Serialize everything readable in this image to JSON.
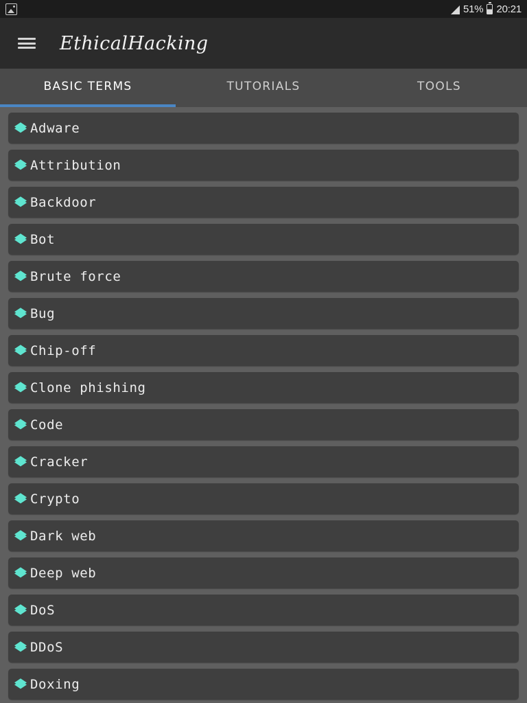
{
  "status_bar": {
    "notification_icon": "image-notification-icon",
    "signal_icon": "signal-bars-icon",
    "battery_percent": "51%",
    "battery_icon": "battery-icon",
    "time": "20:21"
  },
  "app_bar": {
    "menu_icon": "hamburger-menu-icon",
    "title": "EthicalHacking"
  },
  "tabs": [
    {
      "label": "BASIC TERMS",
      "active": true
    },
    {
      "label": "TUTORIALS",
      "active": false
    },
    {
      "label": "TOOLS",
      "active": false
    }
  ],
  "colors": {
    "status_bar_bg": "#1c1c1c",
    "app_bar_bg": "#2b2b2b",
    "tab_bar_bg": "#4a4a4a",
    "tab_indicator": "#4a86c4",
    "page_bg": "#5f5f5f",
    "card_bg": "#3f3f3f",
    "accent_icon": "#5fe5d0",
    "text_primary": "#ededed"
  },
  "list": {
    "item_icon": "layers-icon",
    "items": [
      {
        "label": "Adware"
      },
      {
        "label": "Attribution"
      },
      {
        "label": "Backdoor"
      },
      {
        "label": "Bot"
      },
      {
        "label": "Brute force"
      },
      {
        "label": "Bug"
      },
      {
        "label": "Chip-off"
      },
      {
        "label": "Clone phishing"
      },
      {
        "label": "Code"
      },
      {
        "label": "Cracker"
      },
      {
        "label": "Crypto"
      },
      {
        "label": "Dark web"
      },
      {
        "label": "Deep web"
      },
      {
        "label": "DoS"
      },
      {
        "label": "DDoS"
      },
      {
        "label": "Doxing"
      }
    ]
  }
}
